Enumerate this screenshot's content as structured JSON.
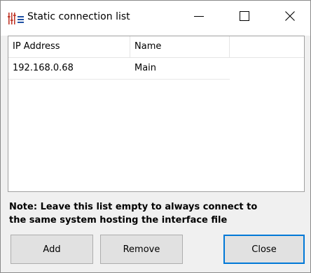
{
  "window": {
    "title": "Static connection list",
    "controls": {
      "minimize": "minimize-icon",
      "maximize": "maximize-icon",
      "close": "close-icon"
    }
  },
  "list": {
    "columns": [
      "IP Address",
      "Name",
      ""
    ],
    "rows": [
      {
        "ip": "192.168.0.68",
        "name": "Main"
      }
    ]
  },
  "note": {
    "line1": "Note: Leave this list empty to always connect to",
    "line2": "the same system hosting the interface file"
  },
  "buttons": {
    "add": "Add",
    "remove": "Remove",
    "close": "Close"
  },
  "colors": {
    "accent": "#0078d7",
    "app_icon": "#c0392b"
  }
}
